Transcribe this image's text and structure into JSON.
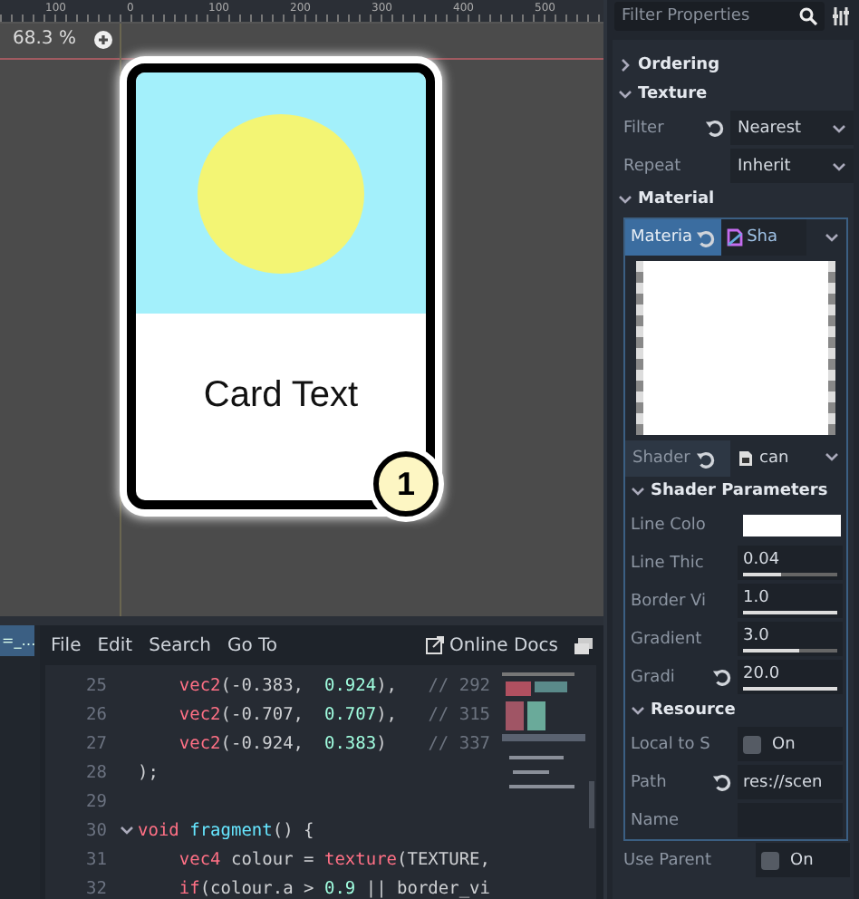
{
  "ruler": {
    "labels": [
      "100",
      "0",
      "100",
      "200",
      "300",
      "400",
      "500"
    ]
  },
  "viewport": {
    "zoom": "68.3 %",
    "card": {
      "text": "Card Text",
      "badge": "1"
    }
  },
  "script_editor": {
    "tab": "=_…",
    "menu": [
      "File",
      "Edit",
      "Search",
      "Go To"
    ],
    "docs_link": "Online Docs",
    "lines": [
      {
        "number": "25",
        "expanded": false,
        "tokens": [
          {
            "text": "    vec2",
            "kind": "type"
          },
          {
            "text": "(-0.383,  ",
            "kind": "plain"
          },
          {
            "text": "0.924",
            "kind": "number"
          },
          {
            "text": "),   ",
            "kind": "plain"
          },
          {
            "text": "// 292",
            "kind": "comment"
          }
        ]
      },
      {
        "number": "26",
        "expanded": false,
        "tokens": [
          {
            "text": "    vec2",
            "kind": "type"
          },
          {
            "text": "(-0.707,  ",
            "kind": "plain"
          },
          {
            "text": "0.707",
            "kind": "number"
          },
          {
            "text": "),   ",
            "kind": "plain"
          },
          {
            "text": "// 315",
            "kind": "comment"
          }
        ]
      },
      {
        "number": "27",
        "expanded": false,
        "tokens": [
          {
            "text": "    vec2",
            "kind": "type"
          },
          {
            "text": "(-0.924,  ",
            "kind": "plain"
          },
          {
            "text": "0.383",
            "kind": "number"
          },
          {
            "text": ")    ",
            "kind": "plain"
          },
          {
            "text": "// 337",
            "kind": "comment"
          }
        ]
      },
      {
        "number": "28",
        "expanded": false,
        "tokens": [
          {
            "text": ");",
            "kind": "plain"
          }
        ]
      },
      {
        "number": "29",
        "expanded": false
      },
      {
        "number": "30",
        "expanded": true,
        "tokens": [
          {
            "text": "void ",
            "kind": "keyword"
          },
          {
            "text": "fragment",
            "kind": "function"
          },
          {
            "text": "() {",
            "kind": "plain"
          }
        ]
      },
      {
        "number": "31",
        "expanded": false,
        "tokens": [
          {
            "text": "    vec4 ",
            "kind": "type"
          },
          {
            "text": "colour = ",
            "kind": "plain"
          },
          {
            "text": "texture",
            "kind": "type"
          },
          {
            "text": "(TEXTURE,",
            "kind": "plain"
          }
        ]
      },
      {
        "number": "32",
        "expanded": false,
        "tokens": [
          {
            "text": "    if",
            "kind": "keyword"
          },
          {
            "text": "(colour.a > ",
            "kind": "plain"
          },
          {
            "text": "0.9",
            "kind": "number"
          },
          {
            "text": " || border_vi",
            "kind": "plain"
          }
        ]
      }
    ]
  },
  "inspector": {
    "filter": {
      "placeholder": "Filter Properties"
    },
    "sections": [
      {
        "title": "Ordering",
        "expanded": false
      },
      {
        "title": "Texture",
        "expanded": true,
        "rows": [
          {
            "kind": "dropdown",
            "label": "Filter",
            "value": "Nearest",
            "revertable": true
          },
          {
            "kind": "dropdown",
            "label": "Repeat",
            "value": "Inherit",
            "revertable": false
          }
        ]
      },
      {
        "title": "Material",
        "expanded": true
      }
    ],
    "material": {
      "tabs": [
        {
          "label": "Materia",
          "selected": true,
          "revertable": true
        },
        {
          "label": "Sha",
          "selected": false,
          "revertable": false
        }
      ],
      "shader": {
        "label": "Shader",
        "value": "can",
        "revertable": true
      },
      "subsections": [
        {
          "title": "Shader Parameters",
          "expanded": true,
          "rows": [
            {
              "kind": "color",
              "label": "Line Colo",
              "color": "#ffffff",
              "revertable": false
            },
            {
              "kind": "slider",
              "label": "Line Thic",
              "value": "0.04",
              "level": 0.4,
              "revertable": false
            },
            {
              "kind": "slider",
              "label": "Border Vi",
              "value": "1.0",
              "level": 1.0,
              "revertable": false
            },
            {
              "kind": "slider",
              "label": "Gradient",
              "value": "3.0",
              "level": 0.6,
              "revertable": false
            },
            {
              "kind": "slider",
              "label": "Gradi",
              "value": "20.0",
              "level": 1.0,
              "revertable": true
            }
          ]
        },
        {
          "title": "Resource",
          "expanded": true,
          "rows": [
            {
              "kind": "check",
              "label": "Local to S",
              "value": "On",
              "checked": false,
              "revertable": false
            },
            {
              "kind": "path",
              "label": "Path",
              "value": "res://scen",
              "revertable": true
            },
            {
              "kind": "text",
              "label": "Name",
              "revertable": false
            }
          ]
        }
      ]
    },
    "footer_rows": [
      {
        "kind": "check",
        "label": "Use Parent",
        "value": "On",
        "checked": false,
        "revertable": false
      }
    ]
  }
}
